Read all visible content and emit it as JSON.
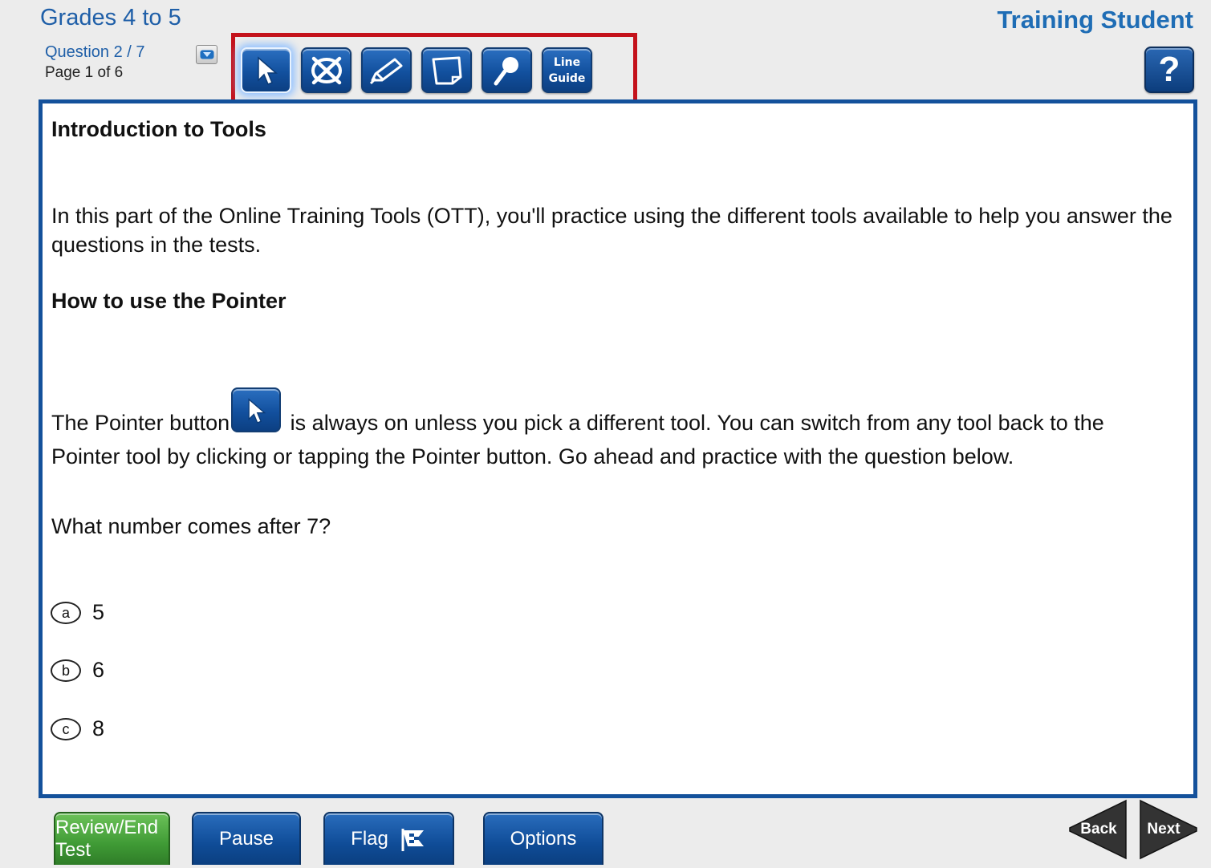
{
  "header": {
    "grade": "Grades 4 to 5",
    "student": "Training Student",
    "question_counter": "Question 2 / 7",
    "page_counter": "Page 1 of 6",
    "help_label": "?"
  },
  "toolbar": {
    "tools": [
      {
        "name": "pointer",
        "icon": "pointer-arrow-icon",
        "active": true
      },
      {
        "name": "eliminate-choice",
        "icon": "eliminate-choice-icon"
      },
      {
        "name": "highlighter",
        "icon": "highlighter-icon"
      },
      {
        "name": "sticky-note",
        "icon": "sticky-note-icon"
      },
      {
        "name": "magnifier",
        "icon": "magnifier-icon"
      },
      {
        "name": "line-guide",
        "label_line1": "Line",
        "label_line2": "Guide"
      }
    ],
    "highlight_color": "#c4121b"
  },
  "content": {
    "heading1": "Introduction to Tools",
    "para1": "In this part of the Online Training Tools (OTT), you'll practice using the different tools available to help you answer the questions in the tests.",
    "heading2": "How to use the Pointer",
    "pointer_text_before": "The Pointer button",
    "pointer_text_after": "is always on unless you pick a different tool. You can switch from any tool back to the Pointer tool by clicking or tapping the Pointer button. Go ahead and practice with the question below.",
    "question": "What number comes after 7?",
    "options": [
      {
        "letter": "a",
        "text": "5"
      },
      {
        "letter": "b",
        "text": "6"
      },
      {
        "letter": "c",
        "text": "8"
      }
    ]
  },
  "footer": {
    "review_end": "Review/End Test",
    "pause": "Pause",
    "flag": "Flag",
    "options": "Options",
    "back": "Back",
    "next": "Next"
  },
  "colors": {
    "title_blue": "#1f5fa8",
    "panel_border": "#14519b",
    "review_green": "#3f9a35"
  }
}
